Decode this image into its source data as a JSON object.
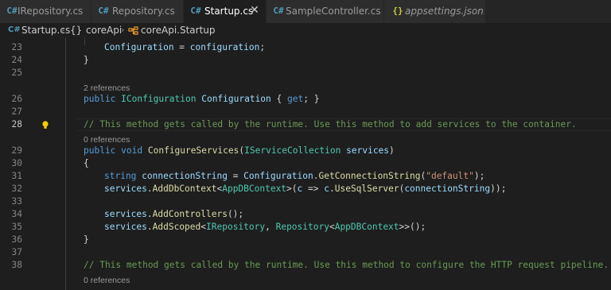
{
  "tabs": [
    {
      "label": "IRepository.cs",
      "icon": "csharp-icon",
      "active": false
    },
    {
      "label": "Repository.cs",
      "icon": "csharp-icon",
      "active": false
    },
    {
      "label": "Startup.cs",
      "icon": "csharp-icon",
      "active": true,
      "close": "✕"
    },
    {
      "label": "SampleController.cs",
      "icon": "csharp-icon",
      "active": false
    },
    {
      "label": "appsettings.json",
      "icon": "json-icon",
      "active": false
    }
  ],
  "breadcrumb": {
    "file": "Startup.cs",
    "sep": "›",
    "namespace_icon": "{}",
    "namespace": "coreApi",
    "class": "coreApi.Startup"
  },
  "editor": {
    "lines": [
      {
        "n": "23"
      },
      {
        "n": "24"
      },
      {
        "n": "25"
      },
      {
        "n": "26"
      },
      {
        "n": "27"
      },
      {
        "n": "28"
      },
      {
        "n": "29"
      },
      {
        "n": "30"
      },
      {
        "n": "31"
      },
      {
        "n": "32"
      },
      {
        "n": "33"
      },
      {
        "n": "34"
      },
      {
        "n": "35"
      },
      {
        "n": "36"
      },
      {
        "n": "37"
      },
      {
        "n": "38"
      }
    ],
    "codelens": [
      "2 references",
      "0 references",
      "0 references"
    ],
    "code": {
      "l23": [
        "Configuration",
        " = ",
        "configuration",
        ";"
      ],
      "l24": "}",
      "l26": [
        "public",
        " ",
        "IConfiguration",
        " ",
        "Configuration",
        " { ",
        "get",
        "; }"
      ],
      "l28": "// This method gets called by the runtime. Use this method to add services to the container.",
      "l29": [
        "public",
        " ",
        "void",
        " ",
        "ConfigureServices",
        "(",
        "IServiceCollection",
        " ",
        "services",
        ")"
      ],
      "l30": "{",
      "l31": [
        "string",
        " ",
        "connectionString",
        " = ",
        "Configuration",
        ".",
        "GetConnectionString",
        "(",
        "\"default\"",
        ");"
      ],
      "l32": [
        "services",
        ".",
        "AddDbContext",
        "<",
        "AppDBContext",
        ">(",
        "c",
        " => ",
        "c",
        ".",
        "UseSqlServer",
        "(",
        "connectionString",
        "));"
      ],
      "l34": [
        "services",
        ".",
        "AddControllers",
        "();"
      ],
      "l35": [
        "services",
        ".",
        "AddScoped",
        "<",
        "IRepository",
        ", ",
        "Repository",
        "<",
        "AppDBContext",
        ">>();"
      ],
      "l36": "}",
      "l38": "// This method gets called by the runtime. Use this method to configure the HTTP request pipeline."
    }
  },
  "colors": {
    "csharp_icon": "#519aba",
    "json_icon": "#cbcb41",
    "lightbulb": "#ffcc00"
  }
}
